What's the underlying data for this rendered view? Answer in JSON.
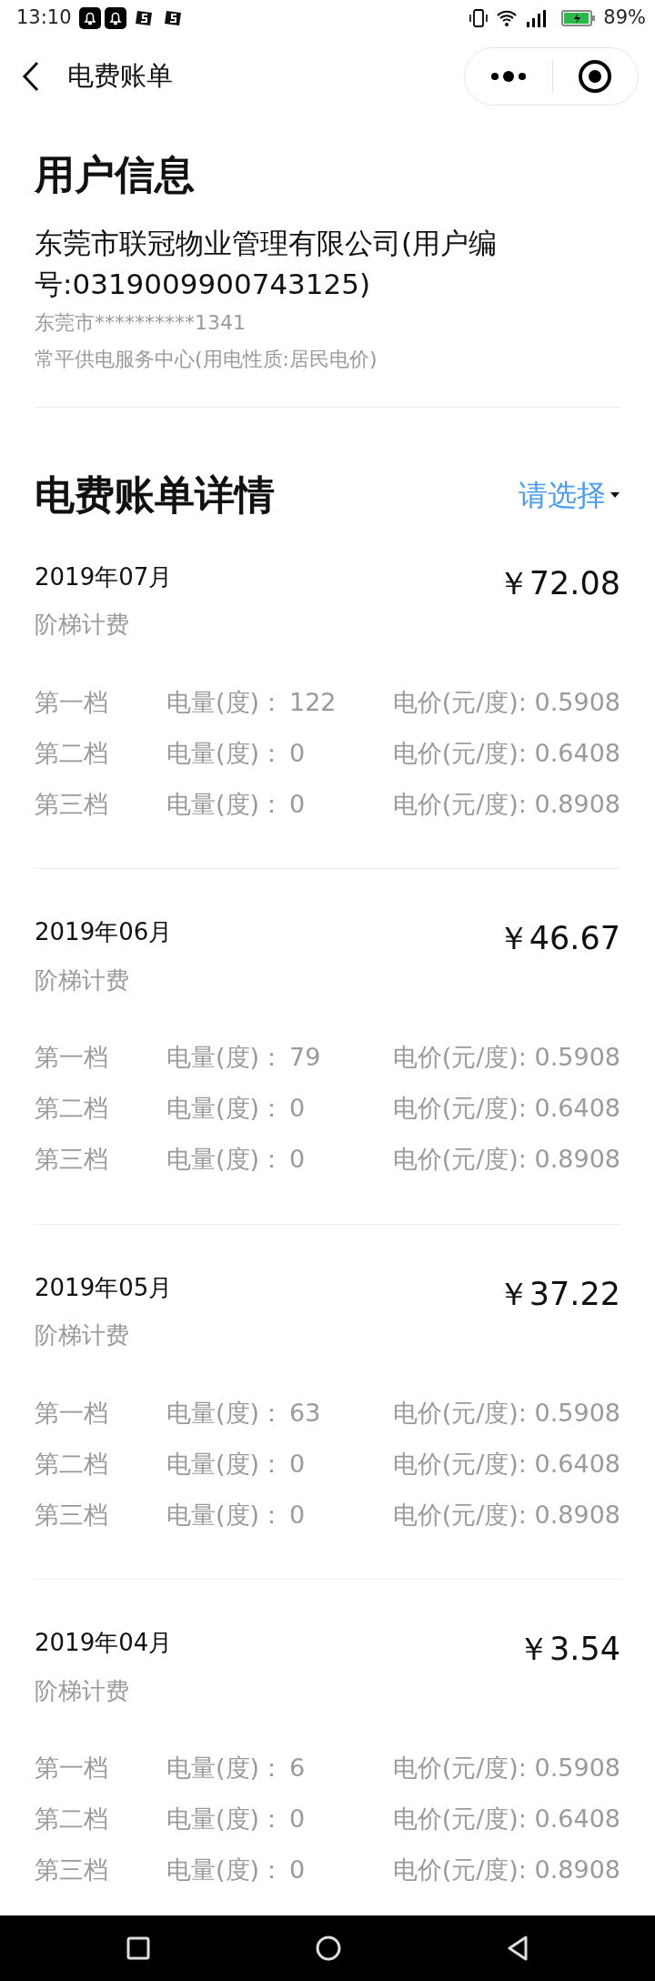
{
  "status_bar": {
    "time": "13:10",
    "battery": "89%"
  },
  "nav": {
    "title": "电费账单"
  },
  "user_info": {
    "title": "用户信息",
    "name": "东莞市联冠物业管理有限公司(用户编号:0319009900743125)",
    "address": "东莞市**********1341",
    "service": "常平供电服务中心(用电性质:居民电价)"
  },
  "bills": {
    "title": "电费账单详情",
    "filter": "请选择",
    "items": [
      {
        "month": "2019年07月",
        "amount": "￥72.08",
        "billing": "阶梯计费",
        "tiers": [
          {
            "name": "第一档",
            "usage_label": "电量(度)：",
            "usage": "122",
            "price": "电价(元/度): 0.5908"
          },
          {
            "name": "第二档",
            "usage_label": "电量(度)：",
            "usage": "0",
            "price": "电价(元/度): 0.6408"
          },
          {
            "name": "第三档",
            "usage_label": "电量(度)：",
            "usage": "0",
            "price": "电价(元/度): 0.8908"
          }
        ]
      },
      {
        "month": "2019年06月",
        "amount": "￥46.67",
        "billing": "阶梯计费",
        "tiers": [
          {
            "name": "第一档",
            "usage_label": "电量(度)：",
            "usage": "79",
            "price": "电价(元/度): 0.5908"
          },
          {
            "name": "第二档",
            "usage_label": "电量(度)：",
            "usage": "0",
            "price": "电价(元/度): 0.6408"
          },
          {
            "name": "第三档",
            "usage_label": "电量(度)：",
            "usage": "0",
            "price": "电价(元/度): 0.8908"
          }
        ]
      },
      {
        "month": "2019年05月",
        "amount": "￥37.22",
        "billing": "阶梯计费",
        "tiers": [
          {
            "name": "第一档",
            "usage_label": "电量(度)：",
            "usage": "63",
            "price": "电价(元/度): 0.5908"
          },
          {
            "name": "第二档",
            "usage_label": "电量(度)：",
            "usage": "0",
            "price": "电价(元/度): 0.6408"
          },
          {
            "name": "第三档",
            "usage_label": "电量(度)：",
            "usage": "0",
            "price": "电价(元/度): 0.8908"
          }
        ]
      },
      {
        "month": "2019年04月",
        "amount": "￥3.54",
        "billing": "阶梯计费",
        "tiers": [
          {
            "name": "第一档",
            "usage_label": "电量(度)：",
            "usage": "6",
            "price": "电价(元/度): 0.5908"
          },
          {
            "name": "第二档",
            "usage_label": "电量(度)：",
            "usage": "0",
            "price": "电价(元/度): 0.6408"
          },
          {
            "name": "第三档",
            "usage_label": "电量(度)：",
            "usage": "0",
            "price": "电价(元/度): 0.8908"
          }
        ]
      }
    ]
  }
}
